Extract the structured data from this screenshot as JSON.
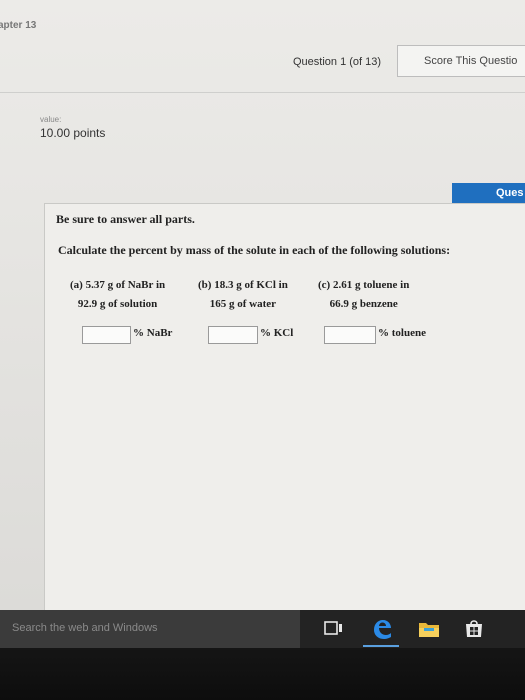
{
  "header": {
    "chapter": "apter 13",
    "question_counter": "Question 1 (of 13)",
    "score_button": "Score This Questio"
  },
  "value": {
    "label": "value:",
    "points": "10.00 points"
  },
  "question_tab": "Ques",
  "question": {
    "instruction": "Be sure to answer all parts.",
    "prompt": "Calculate the percent by mass of the solute in each of the following solutions:",
    "parts": [
      {
        "line1": "(a) 5.37 g of NaBr in",
        "line2": "92.9 g of solution",
        "unit": "% NaBr",
        "answer": ""
      },
      {
        "line1": "(b) 18.3 g of KCl in",
        "line2": "165 g of water",
        "unit": "% KCl",
        "answer": ""
      },
      {
        "line1": "(c) 2.61 g toluene in",
        "line2": "66.9 g benzene",
        "unit": "% toluene",
        "answer": ""
      }
    ]
  },
  "taskbar": {
    "search_placeholder": "Search the web and Windows",
    "icons": [
      "task-view-icon",
      "edge-browser-icon",
      "file-explorer-icon",
      "store-icon"
    ],
    "accent": "#1f6fbf"
  }
}
